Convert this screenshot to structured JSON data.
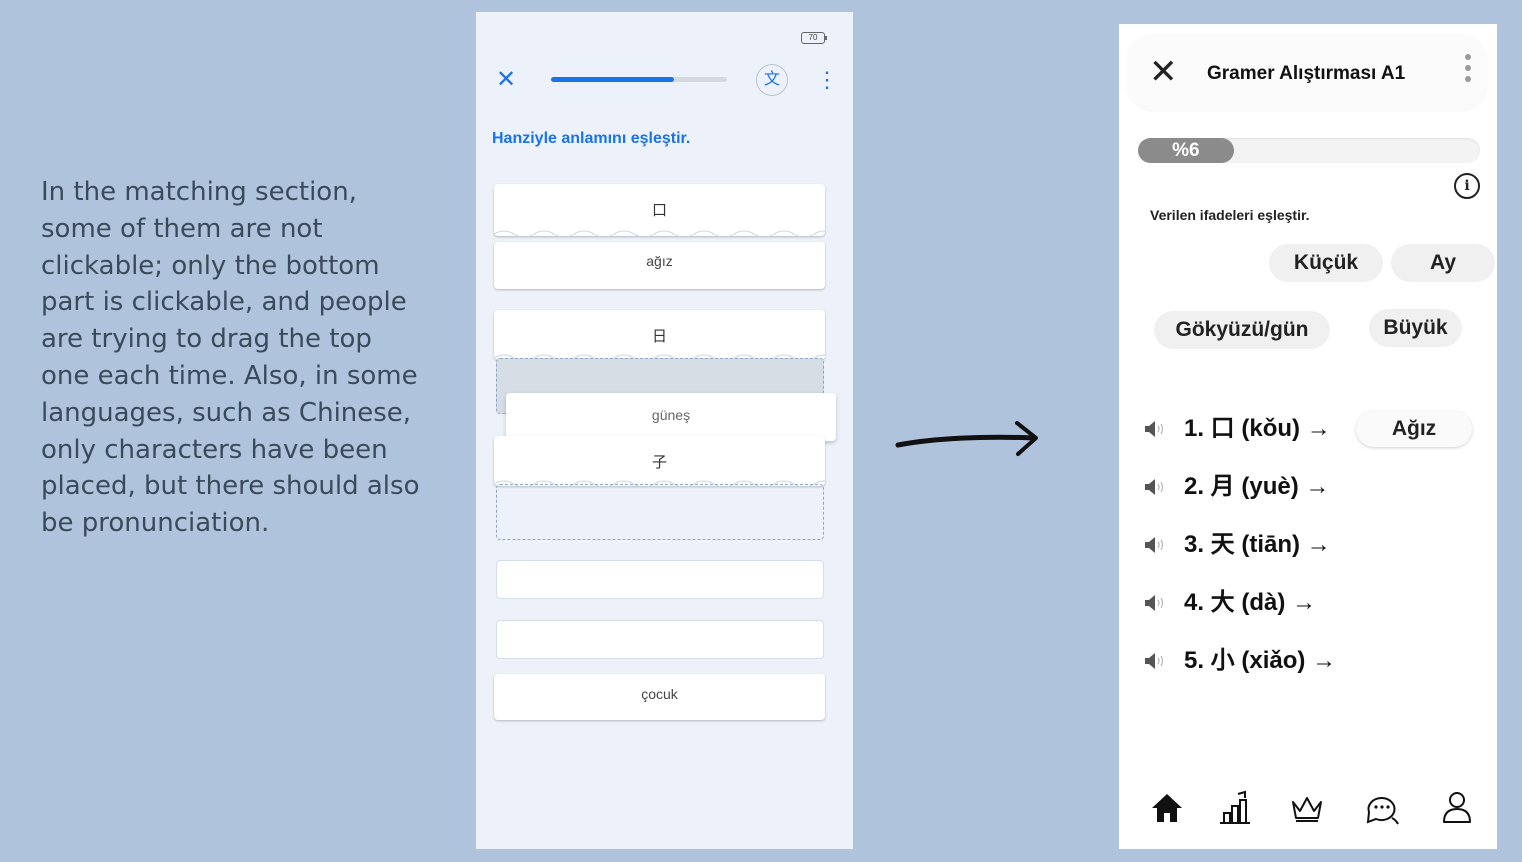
{
  "annotation": {
    "text": "In the matching section, some of them are not clickable; only the bottom part is clickable, and people are trying to drag the top one each time. Also, in some languages, such as Chinese, only characters have been placed, but there should also be pronunciation."
  },
  "before": {
    "battery": "70",
    "progress": 0.7,
    "translate_icon": "文",
    "instruction": "Hanziyle anlamını eşleştir.",
    "pairs": [
      {
        "hanzi": "口",
        "meaning": "ağız"
      },
      {
        "hanzi": "日",
        "meaning": ""
      },
      {
        "hanzi": "子",
        "meaning": ""
      }
    ],
    "dragging_card": "güneş",
    "bottom_card": "çocuk"
  },
  "after": {
    "title": "Gramer Alıştırması A1",
    "progress_label": "%6",
    "progress": 0.06,
    "info_icon": "i",
    "instruction": "Verilen ifadeleri eşleştir.",
    "chips": [
      "Küçük",
      "Ay",
      "Gökyüzü/gün",
      "Büyük"
    ],
    "items": [
      "1. 口 (kǒu) →",
      "2. 月 (yuè) →",
      "3. 天 (tiān) →",
      "4. 大 (dà) →",
      "5. 小 (xiǎo) →"
    ],
    "placed_answer": "Ağız",
    "nav_icons": [
      "home-icon",
      "stats-icon",
      "crown-icon",
      "chat-icon",
      "profile-icon"
    ]
  },
  "colors": {
    "background": "#afc4dc",
    "accent_blue": "#1a73e8"
  }
}
